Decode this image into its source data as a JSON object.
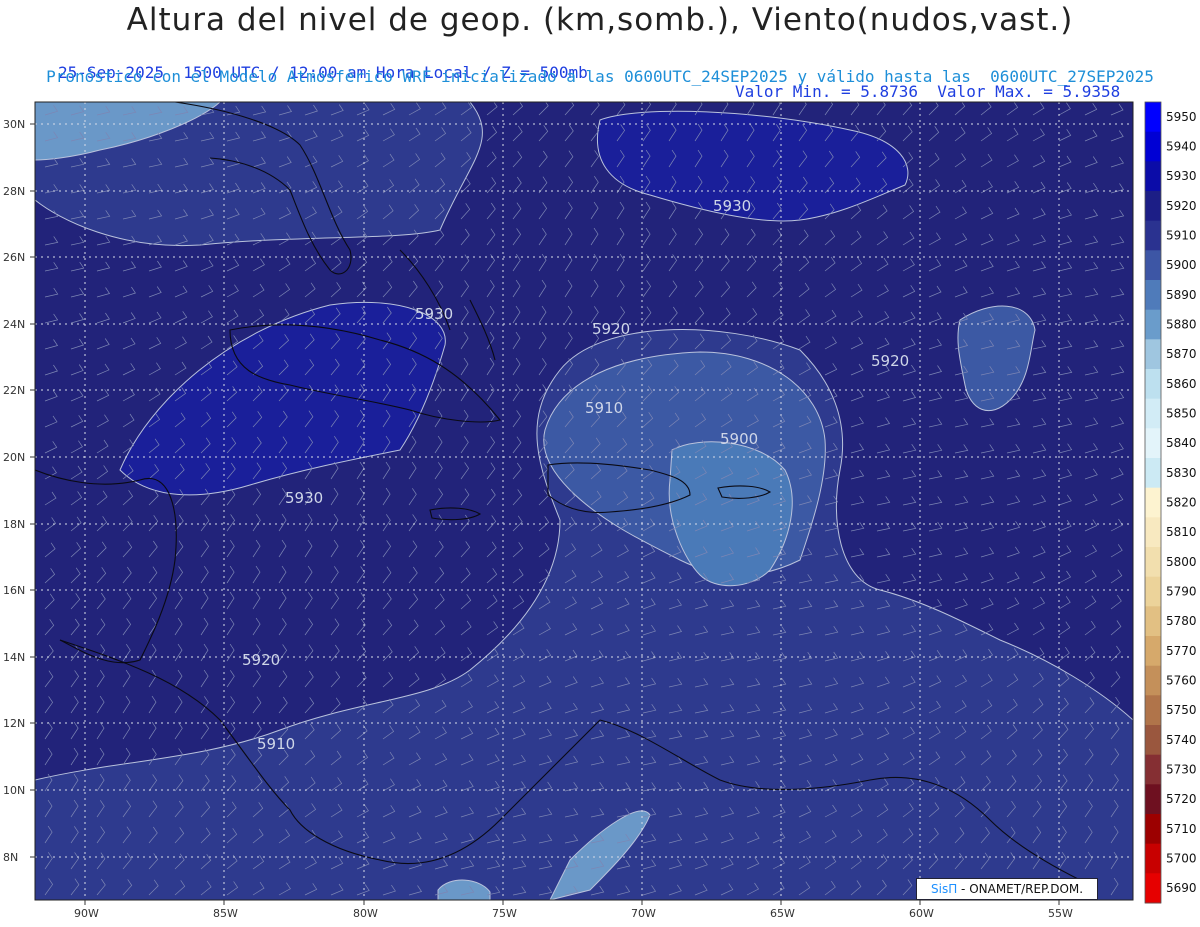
{
  "header": {
    "title": "Altura del nivel de geop. (km,somb.), Viento(nudos,vast.)",
    "line1_left": "25-Sep-2025  1500 UTC / 12:00 am Hora Local / Z = 500mb",
    "line1_right": "Valor Min. = 5.8736  Valor Max. = 5.9358",
    "line2": "Pronóstico con el Modelo Atmosférico WRF inicializado a las 0600UTC_24SEP2025 y válido hasta las  0600UTC_27SEP2025"
  },
  "map": {
    "lat_labels": [
      "30N",
      "28N",
      "26N",
      "24N",
      "22N",
      "20N",
      "18N",
      "16N",
      "14N",
      "12N",
      "10N",
      "8N"
    ],
    "lon_labels": [
      "90W",
      "85W",
      "80W",
      "75W",
      "70W",
      "65W",
      "60W",
      "55W"
    ],
    "contour_labels": [
      "5930",
      "5930",
      "5930",
      "5920",
      "5920",
      "5920",
      "5910",
      "5910",
      "5900"
    ],
    "colors": {
      "c5930": "#1a1f9a",
      "c5920": "#22237a",
      "c5910": "#2e3a8e",
      "c5900": "#3c59a4",
      "c5890": "#4a7ab8",
      "c5880": "#6a98c8",
      "coast": "#0a0a14"
    }
  },
  "colorbar": {
    "levels": [
      "5950",
      "5940",
      "5930",
      "5920",
      "5910",
      "5900",
      "5890",
      "5880",
      "5870",
      "5860",
      "5850",
      "5840",
      "5830",
      "5820",
      "5810",
      "5800",
      "5790",
      "5780",
      "5770",
      "5760",
      "5750",
      "5740",
      "5730",
      "5720",
      "5710",
      "5700",
      "5690"
    ],
    "colors": [
      "#0000ff",
      "#0000d4",
      "#0b0ca8",
      "#1c1e86",
      "#2a3290",
      "#3d56a5",
      "#4f7bba",
      "#6a9ccb",
      "#9fc6e0",
      "#bde0ef",
      "#d2ecf6",
      "#e3f4fa",
      "#cceaf4",
      "#fdf3d0",
      "#f8e9c0",
      "#f2dfae",
      "#ecd39a",
      "#e2c083",
      "#d6a96b",
      "#c4905a",
      "#b0744a",
      "#9a573e",
      "#852f33",
      "#6e1020",
      "#9c0000",
      "#c80000",
      "#e60000"
    ]
  },
  "logo": {
    "brand": "SisΠ",
    "org": " - ONAMET/REP.DOM."
  }
}
